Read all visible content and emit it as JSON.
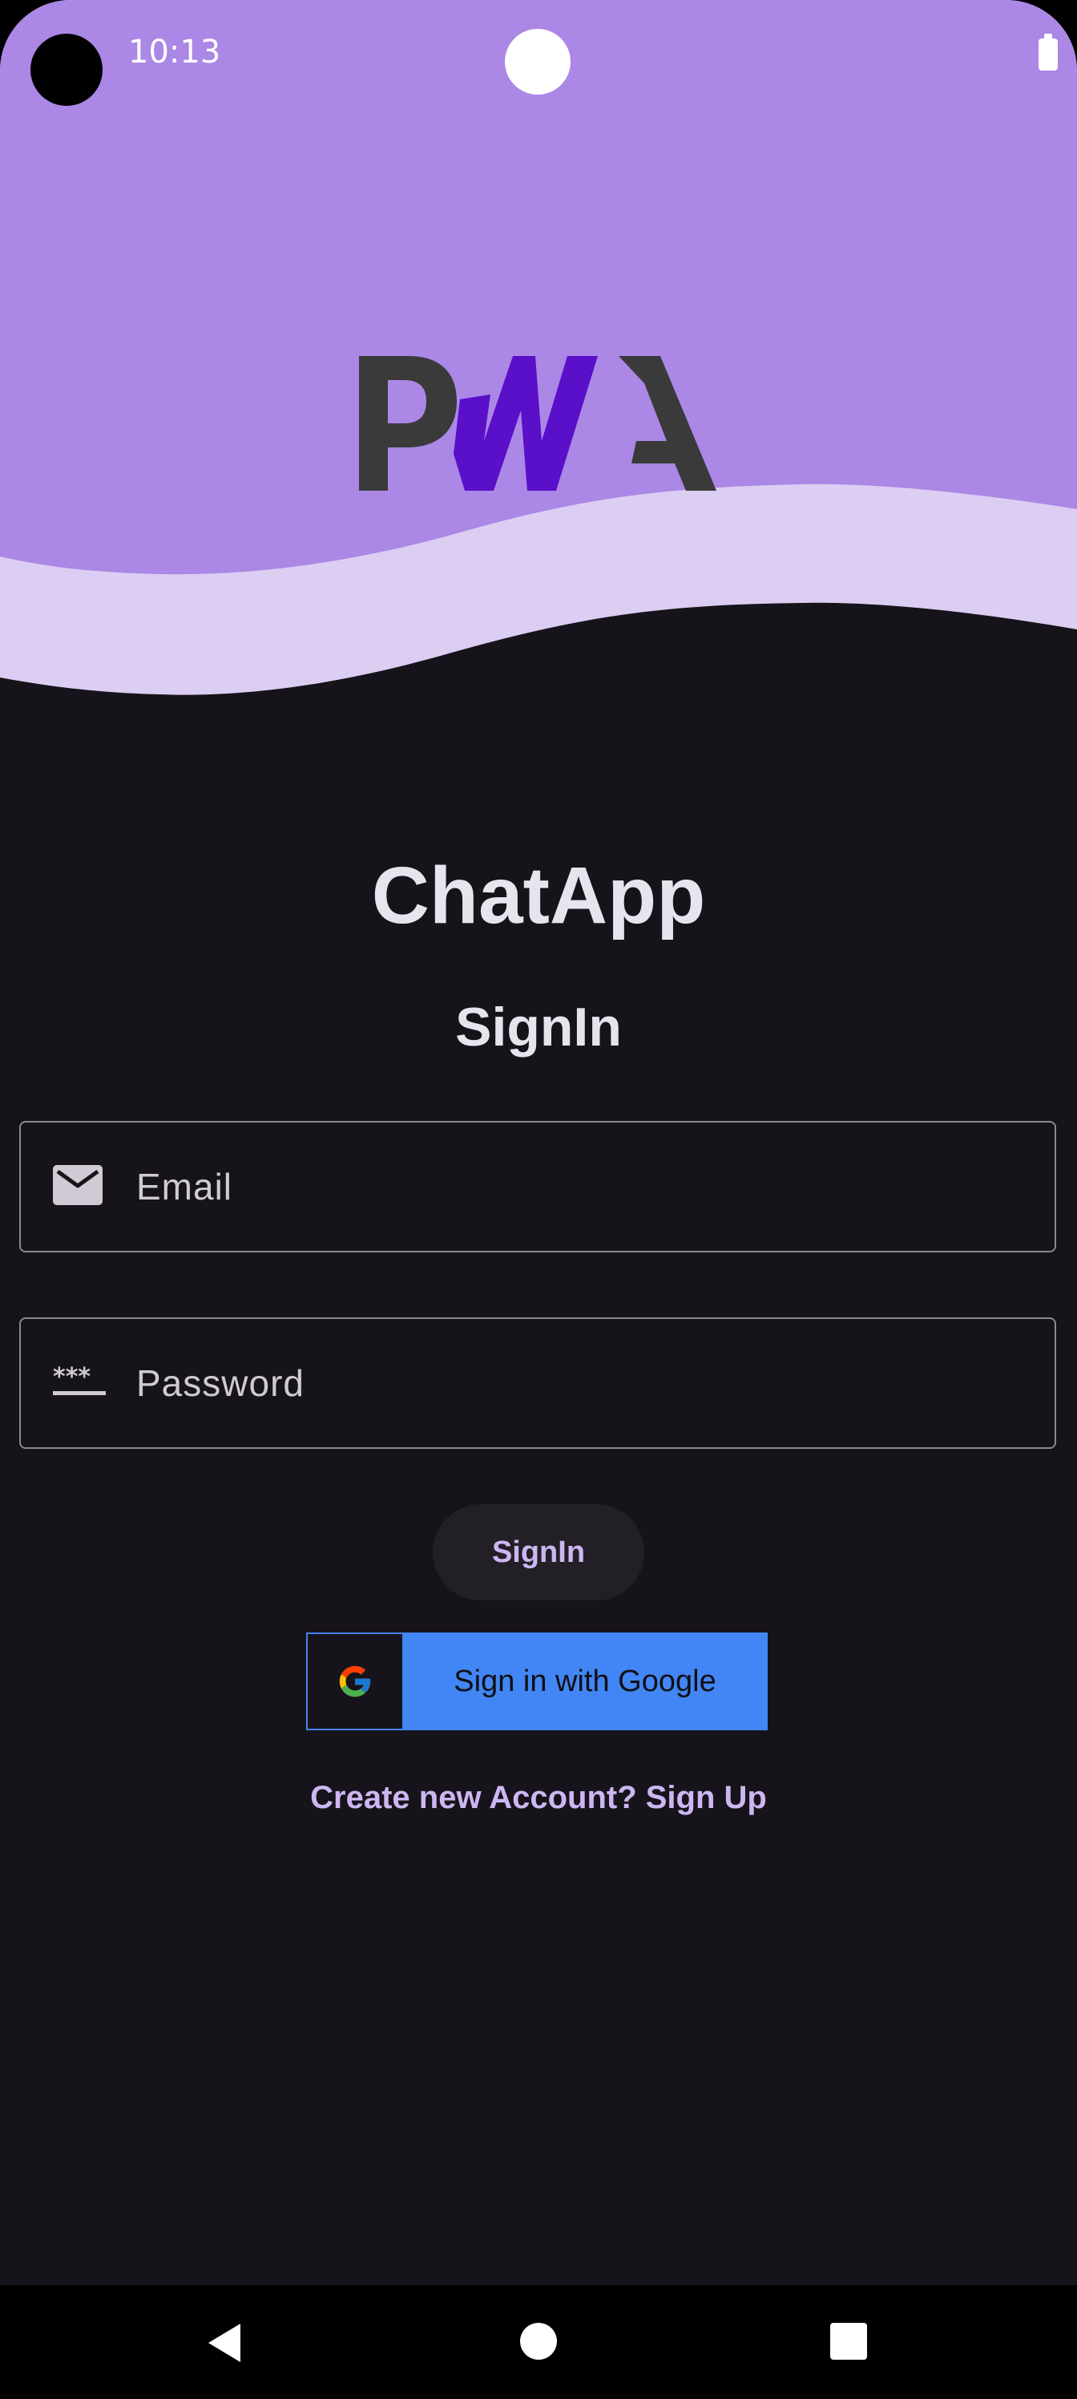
{
  "status_bar": {
    "time": "10:13"
  },
  "header": {
    "logo_text": "PWA",
    "colors": {
      "top_wave": "#ab87e6",
      "band_wave": "#dccdf3",
      "logo_dark": "#3a3a3a",
      "logo_purple": "#5a0fc8"
    }
  },
  "main": {
    "title": "ChatApp",
    "subtitle": "SignIn",
    "email": {
      "placeholder": "Email",
      "icon": "envelope-icon"
    },
    "password": {
      "placeholder": "Password",
      "icon": "password-dots-icon"
    },
    "signin_button": "SignIn",
    "google_button": {
      "label": "Sign in with Google",
      "icon": "google-g-icon"
    },
    "signup_link": "Create new Account? Sign Up"
  },
  "nav": {
    "back": "back-icon",
    "home": "home-icon",
    "recent": "recent-apps-icon"
  },
  "colors": {
    "background": "#16141a",
    "accent": "#cdb6f2",
    "google_blue": "#4285f4"
  }
}
